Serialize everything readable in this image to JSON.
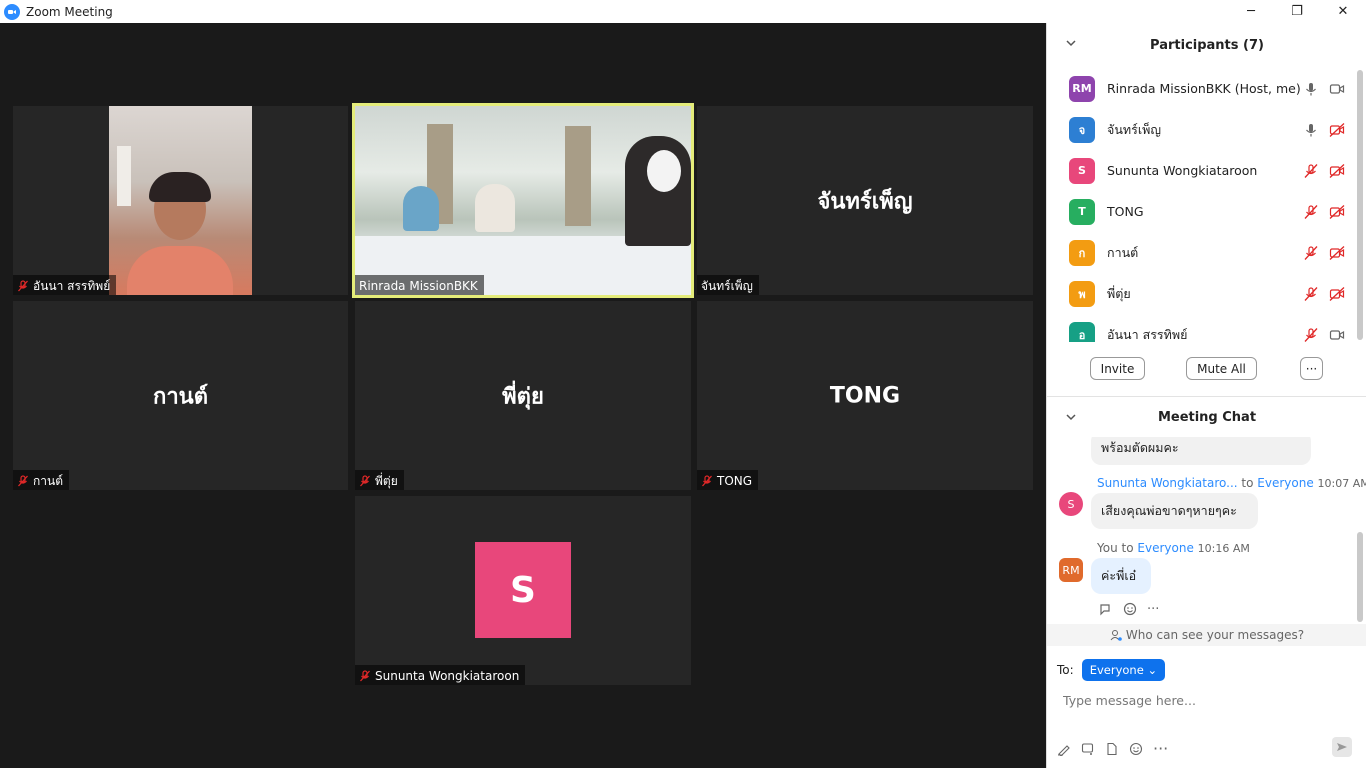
{
  "window": {
    "title": "Zoom Meeting",
    "minimize": "─",
    "restore": "❐",
    "close": "✕"
  },
  "tiles": [
    {
      "name": "อันนา สรรทิพย์",
      "type": "video"
    },
    {
      "name": "Rinrada MissionBKK",
      "type": "video",
      "active_speaker": true
    },
    {
      "name": "จันทร์เพ็ญ",
      "display_name": "จันทร์เพ็ญ",
      "type": "name"
    },
    {
      "name": "กานต์",
      "display_name": "กานต์",
      "type": "name"
    },
    {
      "name": "พี่ตุ่ย",
      "display_name": "พี่ตุ่ย",
      "type": "name"
    },
    {
      "name": "TONG",
      "display_name": "TONG",
      "type": "name"
    },
    {
      "name": "Sununta Wongkiataroon",
      "type": "avatar",
      "avatar_letter": "S",
      "avatar_color": "#e8477b"
    }
  ],
  "participants": {
    "header": "Participants (7)",
    "list": [
      {
        "initials": "RM",
        "color": "#8e44ad",
        "name": "Rinrada MissionBKK (Host, me)",
        "mic": "on",
        "video": "on"
      },
      {
        "initials": "จ",
        "color": "#2d7fd3",
        "name": "จันทร์เพ็ญ",
        "mic": "on",
        "video": "off"
      },
      {
        "initials": "S",
        "color": "#e8477b",
        "name": "Sununta Wongkiataroon",
        "mic": "off",
        "video": "off"
      },
      {
        "initials": "T",
        "color": "#27ae60",
        "name": "TONG",
        "mic": "off",
        "video": "off"
      },
      {
        "initials": "ก",
        "color": "#f39c12",
        "name": "กานต์",
        "mic": "off",
        "video": "off"
      },
      {
        "initials": "พ",
        "color": "#f39c12",
        "name": "พี่ตุ่ย",
        "mic": "off",
        "video": "off"
      },
      {
        "initials": "อ",
        "color": "#16a085",
        "name": "อันนา สรรทิพย์",
        "mic": "off",
        "video": "on"
      }
    ],
    "buttons": {
      "invite": "Invite",
      "mute_all": "Mute All",
      "more": "···"
    }
  },
  "chat": {
    "header": "Meeting Chat",
    "messages": [
      {
        "text": "พร้อมตัดผมคะ"
      },
      {
        "sender": "Sununta Wongkiataro...",
        "to_word": "to",
        "to": "Everyone",
        "time": "10:07 AM",
        "avatar": "S",
        "avatar_color": "#e8477b",
        "text": "เสียงคุณพ่อขาดๆหายๆคะ"
      },
      {
        "sender": "You",
        "to_word": "to",
        "to": "Everyone",
        "time": "10:16 AM",
        "avatar": "RM",
        "avatar_color": "#e06a2c",
        "text": "ค่ะพี่เอ๋"
      }
    ],
    "privacy": "Who can see your messages?",
    "to_label": "To:",
    "to_value": "Everyone",
    "input_placeholder": "Type message here..."
  }
}
